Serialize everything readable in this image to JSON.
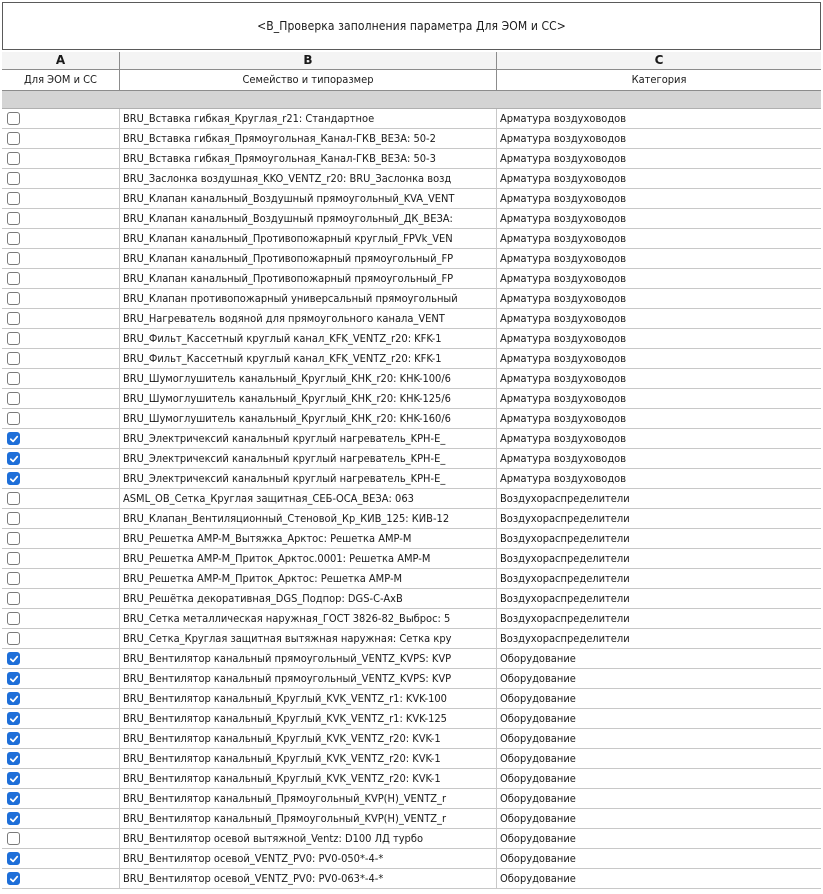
{
  "schedule": {
    "title": "<В_Проверка заполнения параметра Для ЭОМ и СС>",
    "column_letters": [
      "A",
      "B",
      "C"
    ],
    "column_headers": [
      "Для ЭОМ и СС",
      "Семейство и типоразмер",
      "Категория"
    ]
  },
  "rows": [
    {
      "checked": false,
      "family": "BRU_Вставка гибкая_Круглая_r21: Стандартное",
      "category": "Арматура воздуховодов"
    },
    {
      "checked": false,
      "family": "BRU_Вставка гибкая_Прямоугольная_Канал-ГКВ_ВЕЗА: 50-2",
      "category": "Арматура воздуховодов"
    },
    {
      "checked": false,
      "family": "BRU_Вставка гибкая_Прямоугольная_Канал-ГКВ_ВЕЗА: 50-3",
      "category": "Арматура воздуховодов"
    },
    {
      "checked": false,
      "family": "BRU_Заслонка воздушная_KKO_VENTZ_r20: BRU_Заслонка возд",
      "category": "Арматура воздуховодов"
    },
    {
      "checked": false,
      "family": "BRU_Клапан канальный_Воздушный прямоугольный_KVA_VENT",
      "category": "Арматура воздуховодов"
    },
    {
      "checked": false,
      "family": "BRU_Клапан канальный_Воздушный прямоугольный_ДК_ВЕЗА:",
      "category": "Арматура воздуховодов"
    },
    {
      "checked": false,
      "family": "BRU_Клапан канальный_Противопожарный круглый_FPVk_VEN",
      "category": "Арматура воздуховодов"
    },
    {
      "checked": false,
      "family": "BRU_Клапан канальный_Противопожарный прямоугольный_FP",
      "category": "Арматура воздуховодов"
    },
    {
      "checked": false,
      "family": "BRU_Клапан канальный_Противопожарный прямоугольный_FP",
      "category": "Арматура воздуховодов"
    },
    {
      "checked": false,
      "family": "BRU_Клапан противопожарный универсальный прямоугольный",
      "category": "Арматура воздуховодов"
    },
    {
      "checked": false,
      "family": "BRU_Нагреватель водяной для прямоугольного канала_VENT",
      "category": "Арматура воздуховодов"
    },
    {
      "checked": false,
      "family": "BRU_Фильт_Кассетный круглый канал_KFK_VENTZ_r20: KFK-1",
      "category": "Арматура воздуховодов"
    },
    {
      "checked": false,
      "family": "BRU_Фильт_Кассетный круглый канал_KFK_VENTZ_r20: KFK-1",
      "category": "Арматура воздуховодов"
    },
    {
      "checked": false,
      "family": "BRU_Шумоглушитель канальный_Круглый_KHK_r20: KHK-100/6",
      "category": "Арматура воздуховодов"
    },
    {
      "checked": false,
      "family": "BRU_Шумоглушитель канальный_Круглый_KHK_r20: KHK-125/6",
      "category": "Арматура воздуховодов"
    },
    {
      "checked": false,
      "family": "BRU_Шумоглушитель канальный_Круглый_KHK_r20: KHK-160/6",
      "category": "Арматура воздуховодов"
    },
    {
      "checked": true,
      "family": "BRU_Электричексий канальный круглый нагреватель_KPH-E_",
      "category": "Арматура воздуховодов"
    },
    {
      "checked": true,
      "family": "BRU_Электричексий канальный круглый нагреватель_KPH-E_",
      "category": "Арматура воздуховодов"
    },
    {
      "checked": true,
      "family": "BRU_Электричексий канальный круглый нагреватель_KPH-E_",
      "category": "Арматура воздуховодов"
    },
    {
      "checked": false,
      "family": "ASML_OB_Сетка_Круглая защитная_СЕБ-ОСА_ВЕЗА: 063",
      "category": "Воздухораспределители"
    },
    {
      "checked": false,
      "family": "BRU_Клапан_Вентиляционный_Стеновой_Кр_КИВ_125: КИВ-12",
      "category": "Воздухораспределители"
    },
    {
      "checked": false,
      "family": "BRU_Решетка AMP-M_Вытяжка_Арктос: Решетка AMP-M",
      "category": "Воздухораспределители"
    },
    {
      "checked": false,
      "family": "BRU_Решетка AMP-M_Приток_Арктос.0001: Решетка AMP-M",
      "category": "Воздухораспределители"
    },
    {
      "checked": false,
      "family": "BRU_Решетка AMP-M_Приток_Арктос: Решетка AMP-M",
      "category": "Воздухораспределители"
    },
    {
      "checked": false,
      "family": "BRU_Решётка декоративная_DGS_Подпор: DGS-C-AxB",
      "category": "Воздухораспределители"
    },
    {
      "checked": false,
      "family": "BRU_Сетка металлическая наружная_ГОСТ 3826-82_Выброс: 5",
      "category": "Воздухораспределители"
    },
    {
      "checked": false,
      "family": "BRU_Сетка_Круглая защитная вытяжная наружная: Сетка кру",
      "category": "Воздухораспределители"
    },
    {
      "checked": true,
      "family": "BRU_Вентилятор канальный прямоугольный_VENTZ_KVPS: KVP",
      "category": "Оборудование"
    },
    {
      "checked": true,
      "family": "BRU_Вентилятор канальный прямоугольный_VENTZ_KVPS: KVP",
      "category": "Оборудование"
    },
    {
      "checked": true,
      "family": "BRU_Вентилятор канальный_Круглый_KVK_VENTZ_r1: KVK-100",
      "category": "Оборудование"
    },
    {
      "checked": true,
      "family": "BRU_Вентилятор канальный_Круглый_KVK_VENTZ_r1: KVK-125",
      "category": "Оборудование"
    },
    {
      "checked": true,
      "family": "BRU_Вентилятор канальный_Круглый_KVK_VENTZ_r20: KVK-1",
      "category": "Оборудование"
    },
    {
      "checked": true,
      "family": "BRU_Вентилятор канальный_Круглый_KVK_VENTZ_r20: KVK-1",
      "category": "Оборудование"
    },
    {
      "checked": true,
      "family": "BRU_Вентилятор канальный_Круглый_KVK_VENTZ_r20: KVK-1",
      "category": "Оборудование"
    },
    {
      "checked": true,
      "family": "BRU_Вентилятор канальный_Прямоугольный_KVP(H)_VENTZ_r",
      "category": "Оборудование"
    },
    {
      "checked": true,
      "family": "BRU_Вентилятор канальный_Прямоугольный_KVP(H)_VENTZ_r",
      "category": "Оборудование"
    },
    {
      "checked": false,
      "family": "BRU_Вентилятор осевой вытяжной_Ventz: D100 ЛД турбо",
      "category": "Оборудование"
    },
    {
      "checked": true,
      "family": "BRU_Вентилятор осевой_VENTZ_PV0: PV0-050*-4-*",
      "category": "Оборудование"
    },
    {
      "checked": true,
      "family": "BRU_Вентилятор осевой_VENTZ_PV0: PV0-063*-4-*",
      "category": "Оборудование"
    }
  ]
}
